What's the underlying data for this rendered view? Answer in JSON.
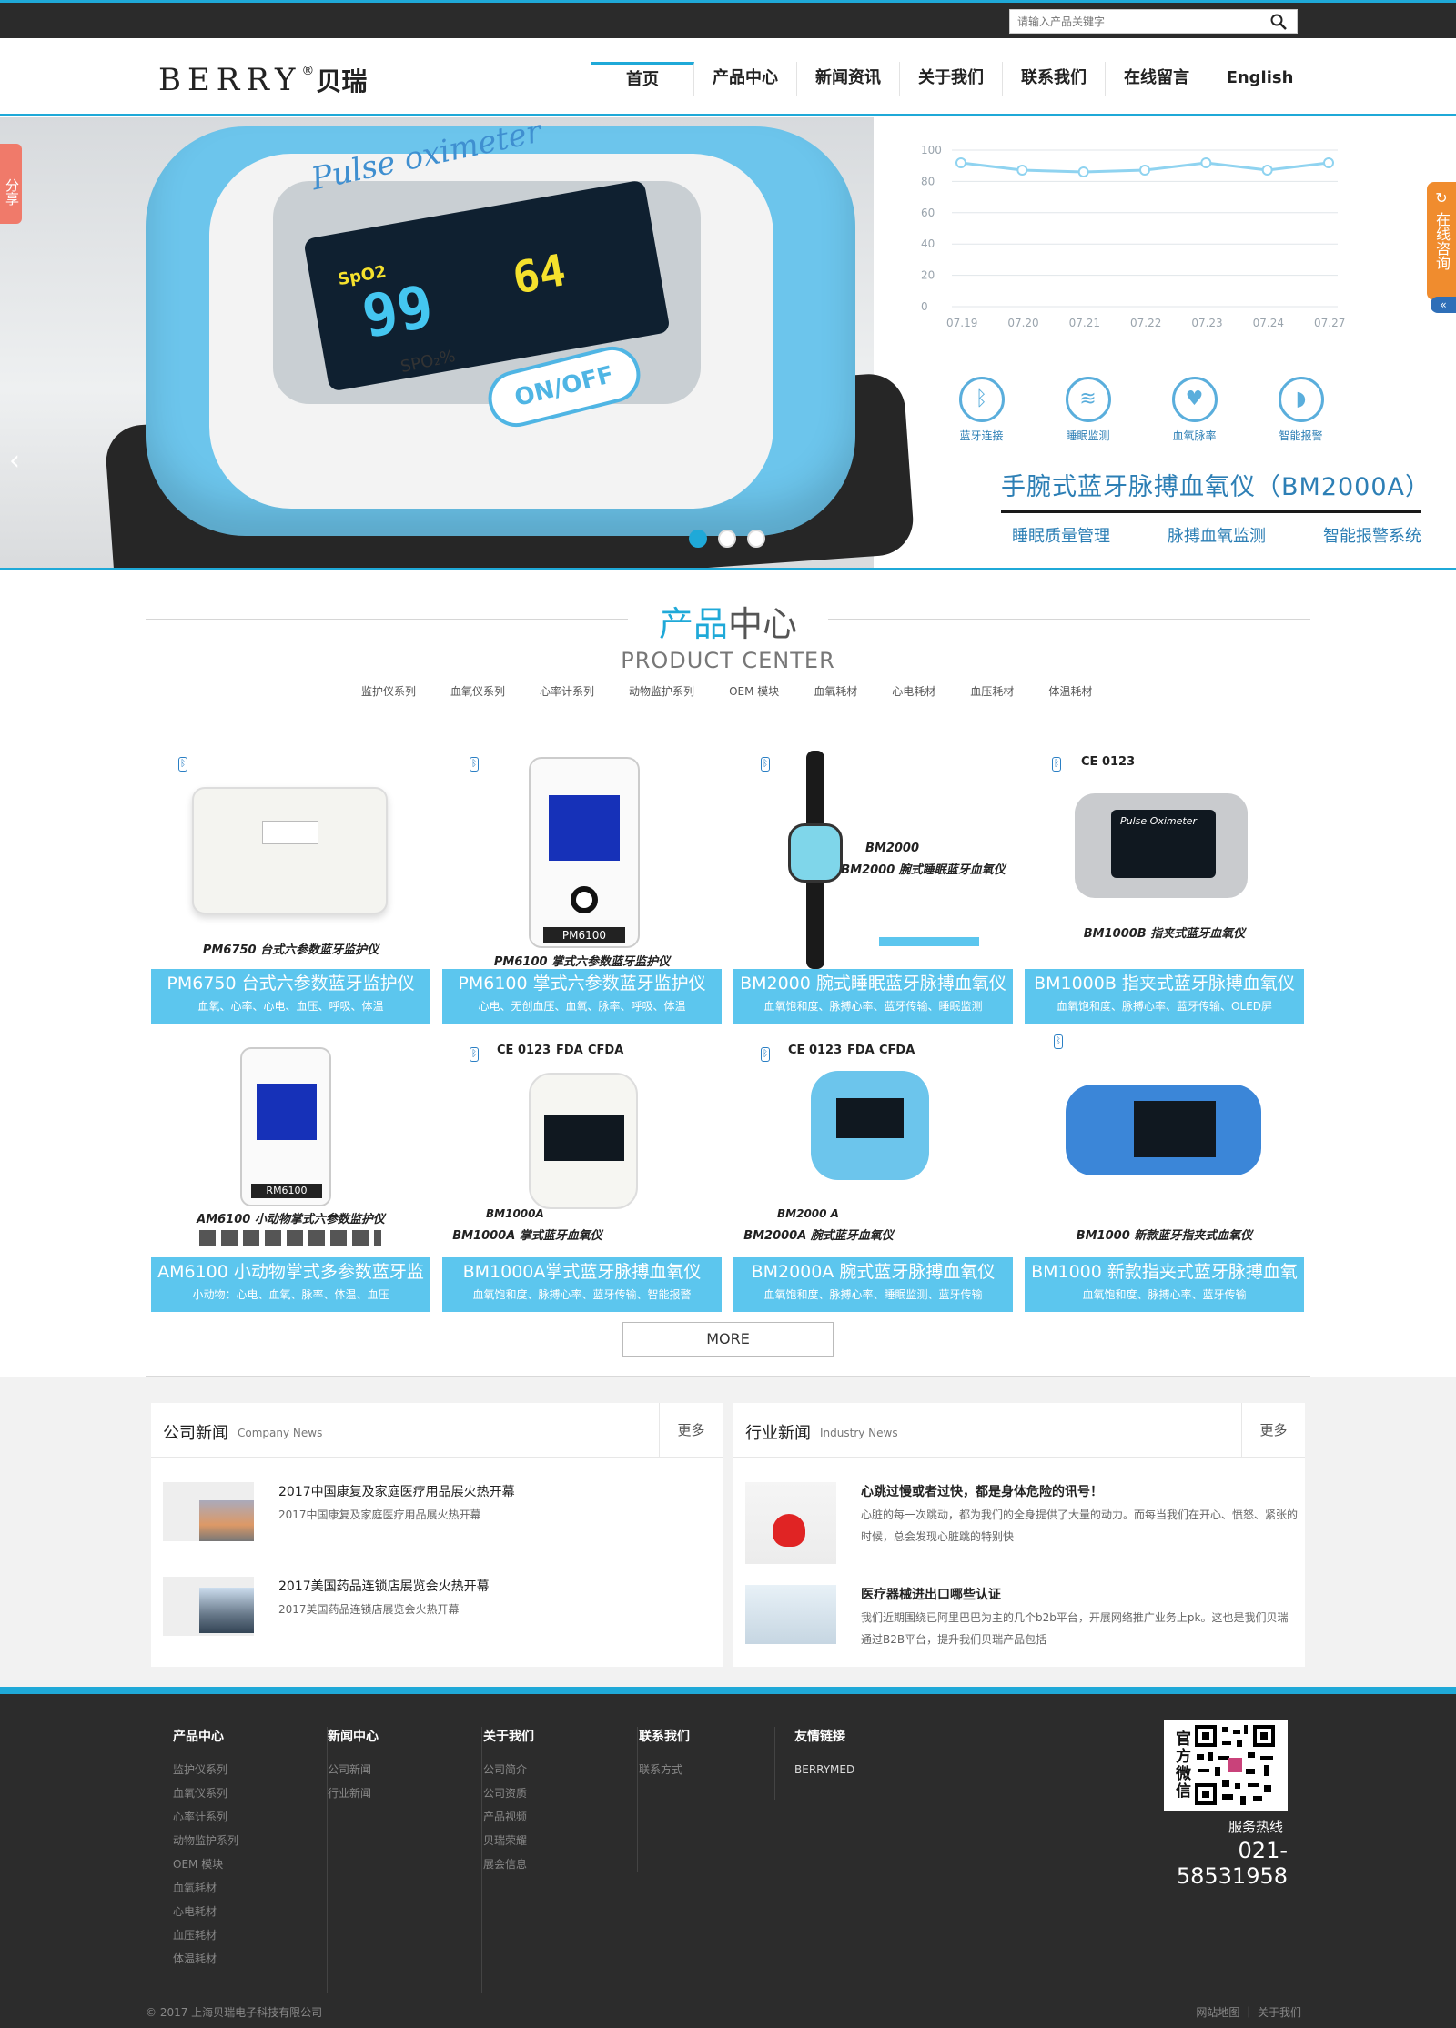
{
  "search": {
    "placeholder": "请输入产品关键字"
  },
  "logo": {
    "en": "BERRY",
    "reg": "®",
    "cn": "贝瑞"
  },
  "nav": [
    "首页",
    "产品中心",
    "新闻资讯",
    "关于我们",
    "联系我们",
    "在线留言",
    "English"
  ],
  "banner": {
    "pulse_text": "Pulse oximeter",
    "spo2": "SpO2",
    "value1": "99",
    "value2": "64",
    "spo2_unit": "SPO₂%",
    "onoff": "ON/OFF",
    "chart_y_labels": [
      "100",
      "80",
      "60",
      "40",
      "20",
      "0"
    ],
    "chart_x_labels": [
      "07.19",
      "07.20",
      "07.21",
      "07.22",
      "07.23",
      "07.24",
      "07.27"
    ],
    "features": [
      {
        "icon": "bluetooth-icon",
        "label": "蓝牙连接"
      },
      {
        "icon": "sleep-monitor-icon",
        "label": "睡眠监测"
      },
      {
        "icon": "heart-rate-icon",
        "label": "血氧脉率"
      },
      {
        "icon": "smart-alarm-icon",
        "label": "智能报警"
      }
    ],
    "title": "手腕式蓝牙脉搏血氧仪（BM2000A）",
    "subs": [
      "睡眠质量管理",
      "脉搏血氧监测",
      "智能报警系统"
    ]
  },
  "side": {
    "share": "分享",
    "consult": "在线咨询"
  },
  "product_center": {
    "title_a": "产品",
    "title_b": "中心",
    "en": "PRODUCT CENTER",
    "categories": [
      "监护仪系列",
      "血氧仪系列",
      "心率计系列",
      "动物监护系列",
      "OEM 模块",
      "血氧耗材",
      "心电耗材",
      "血压耗材",
      "体温耗材"
    ],
    "products": [
      {
        "img_label": "PM6750 台式六参数蓝牙监护仪",
        "title": "PM6750 台式六参数蓝牙监护仪",
        "sub": "血氧、心率、心电、血压、呼吸、体温"
      },
      {
        "img_label": "PM6100 掌式六参数蓝牙监护仪",
        "title": "PM6100 掌式六参数蓝牙监护仪",
        "sub": "心电、无创血压、血氧、脉率、呼吸、体温"
      },
      {
        "img_label": "BM2000 腕式睡眠蓝牙血氧仪",
        "title": "BM2000 腕式睡眠蓝牙脉搏血氧仪",
        "sub": "血氧饱和度、脉搏心率、蓝牙传输、睡眠监测"
      },
      {
        "img_label": "BM1000B 指夹式蓝牙血氧仪",
        "title": "BM1000B 指夹式蓝牙脉搏血氧仪",
        "sub": "血氧饱和度、脉搏心率、蓝牙传输、OLED屏"
      },
      {
        "img_label": "AM6100 小动物掌式六参数监护仪",
        "title": "AM6100 小动物掌式多参数蓝牙监",
        "sub": "小动物：心电、血氧、脉率、体温、血压"
      },
      {
        "img_label": "BM1000A 掌式蓝牙血氧仪",
        "title": "BM1000A掌式蓝牙脉搏血氧仪",
        "sub": "血氧饱和度、脉搏心率、蓝牙传输、智能报警"
      },
      {
        "img_label": "BM2000A 腕式蓝牙血氧仪",
        "title": "BM2000A 腕式蓝牙脉搏血氧仪",
        "sub": "血氧饱和度、脉搏心率、睡眠监测、蓝牙传输"
      },
      {
        "img_label": "BM1000 新款蓝牙指夹式血氧仪",
        "title": "BM1000 新款指夹式蓝牙脉搏血氧",
        "sub": "血氧饱和度、脉搏心率、蓝牙传输"
      }
    ],
    "device_texts": {
      "pm6100": "PM6100",
      "rm6100": "RM6100",
      "pulse_oximeter": "Pulse Oximeter",
      "bm2000": "BM2000",
      "bm1000a": "BM1000A",
      "bm2000a": "BM2000 A",
      "ce": "CE 0123",
      "fda": "FDA",
      "cfda": "CFDA"
    },
    "more": "MORE"
  },
  "news": {
    "company": {
      "title": "公司新闻",
      "en": "Company News",
      "more": "更多",
      "items": [
        {
          "title": "2017中国康复及家庭医疗用品展火热开幕",
          "desc": "2017中国康复及家庭医疗用品展火热开幕"
        },
        {
          "title": "2017美国药品连锁店展览会火热开幕",
          "desc": "2017美国药品连锁店展览会火热开幕"
        }
      ]
    },
    "industry": {
      "title": "行业新闻",
      "en": "Industry News",
      "more": "更多",
      "items": [
        {
          "title": "心跳过慢或者过快，都是身体危险的讯号！",
          "desc": "心脏的每一次跳动，都为我们的全身提供了大量的动力。而每当我们在开心、愤怒、紧张的时候，总会发现心脏跳的特别快"
        },
        {
          "title": "医疗器械进出口哪些认证",
          "desc": "我们近期围绕已阿里巴巴为主的几个b2b平台，开展网络推广业务上pk。这也是我们贝瑞通过B2B平台，提升我们贝瑞产品包括"
        }
      ]
    }
  },
  "footer": {
    "columns": [
      {
        "heading": "产品中心",
        "links": [
          "监护仪系列",
          "血氧仪系列",
          "心率计系列",
          "动物监护系列",
          "OEM 模块",
          "血氧耗材",
          "心电耗材",
          "血压耗材",
          "体温耗材"
        ]
      },
      {
        "heading": "新闻中心",
        "links": [
          "公司新闻",
          "行业新闻"
        ]
      },
      {
        "heading": "关于我们",
        "links": [
          "公司简介",
          "公司资质",
          "产品视频",
          "贝瑞荣耀",
          "展会信息"
        ]
      },
      {
        "heading": "联系我们",
        "links": [
          "联系方式"
        ]
      },
      {
        "heading": "友情链接",
        "links": [
          "BERRYMED"
        ]
      }
    ],
    "qr_label": "官方微信",
    "hotline_label": "服务热线",
    "hotline": "021-58531958",
    "copyright": "© 2017 上海贝瑞电子科技有限公司",
    "bottom_links": "网站地图 ｜ 关于我们"
  },
  "colors": {
    "accent": "#1fa9d8",
    "card_caption": "#5cc6ee",
    "dark": "#2c2c2c"
  }
}
